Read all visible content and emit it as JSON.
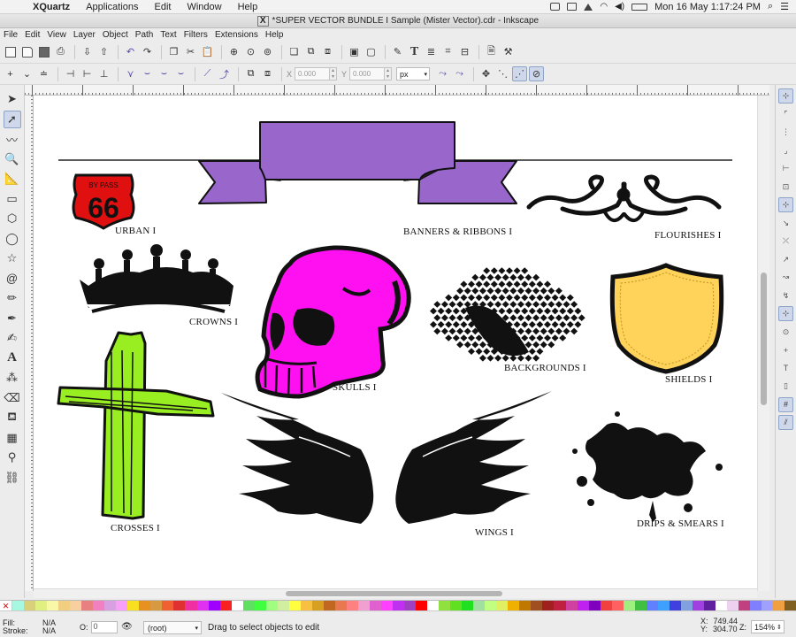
{
  "mac_menubar": {
    "app_name": "XQuartz",
    "menus": [
      "Applications",
      "Edit",
      "Window",
      "Help"
    ],
    "clock": "Mon 16 May  1:17:24 PM"
  },
  "window": {
    "title": "*SUPER VECTOR BUNDLE I Sample (Mister Vector).cdr - Inkscape",
    "x_badge": "X"
  },
  "app_menu": [
    "File",
    "Edit",
    "View",
    "Layer",
    "Object",
    "Path",
    "Text",
    "Filters",
    "Extensions",
    "Help"
  ],
  "controls": {
    "x_label": "X",
    "x_value": "0.000",
    "y_label": "Y",
    "y_value": "0.000",
    "unit": "px"
  },
  "artwork": {
    "labels": {
      "urban": "URBAN I",
      "banners": "BANNERS & RIBBONS I",
      "flourishes": "FLOURISHES I",
      "crowns": "CROWNS I",
      "skulls": "SKULLS I",
      "backgrounds": "BACKGROUNDS I",
      "shields": "SHIELDS I",
      "crosses": "CROSSES I",
      "wings": "WINGS I",
      "drips": "DRIPS & SMEARS I"
    },
    "sign_top": "BY PASS",
    "sign_number": "66",
    "colors": {
      "ribbon": "#9966cc",
      "sign": "#e01010",
      "skull": "#ff10f0",
      "shield": "#ffd35a",
      "cross": "#99ee22"
    }
  },
  "palette": {
    "none_mark": "✕",
    "colors": [
      "#a6f8e0",
      "#d8d07a",
      "#e0f080",
      "#f8f8a8",
      "#f0d080",
      "#f8d0a0",
      "#e88080",
      "#f080c0",
      "#d8a0e0",
      "#f8a0f8",
      "#f8e020",
      "#e89020",
      "#d89a40",
      "#f06030",
      "#e03030",
      "#f030a0",
      "#e030f0",
      "#a000ff",
      "#f82020",
      "#ffffff",
      "#60e060",
      "#40ff40",
      "#a0ff80",
      "#d0f0a0",
      "#ffff40",
      "#f8c040",
      "#d8a020",
      "#c06820",
      "#e87850",
      "#ff8080",
      "#f0a0d0",
      "#e060d0",
      "#ff40ff",
      "#c030f0",
      "#a040c0",
      "#ff0000",
      "#ffffff",
      "#90e040",
      "#60e020",
      "#20e020",
      "#a0e0a0",
      "#c0ff80",
      "#e0f060",
      "#f0b000",
      "#c07800",
      "#a05020",
      "#a02020",
      "#c02040",
      "#d040a0",
      "#c020f0",
      "#8000c0",
      "#f04040",
      "#ff6060",
      "#a0f080",
      "#40c040",
      "#6080ff",
      "#40a0ff",
      "#4040e0",
      "#80a0e0",
      "#a040e0",
      "#6020a0",
      "#ffffff",
      "#f0d0f0",
      "#c04080",
      "#8080ff",
      "#a0a0ff",
      "#f0a040",
      "#806020"
    ]
  },
  "status": {
    "fill_label": "Fill:",
    "fill_value": "N/A",
    "stroke_label": "Stroke:",
    "stroke_value": "N/A",
    "opacity_label": "O:",
    "opacity_value": "0",
    "layer": "(root)",
    "message": "Drag to select objects to edit",
    "x_label": "X:",
    "x_value": "749.44",
    "y_label": "Y:",
    "y_value": "304.70",
    "zoom_label": "Z:",
    "zoom_value": "154%"
  }
}
